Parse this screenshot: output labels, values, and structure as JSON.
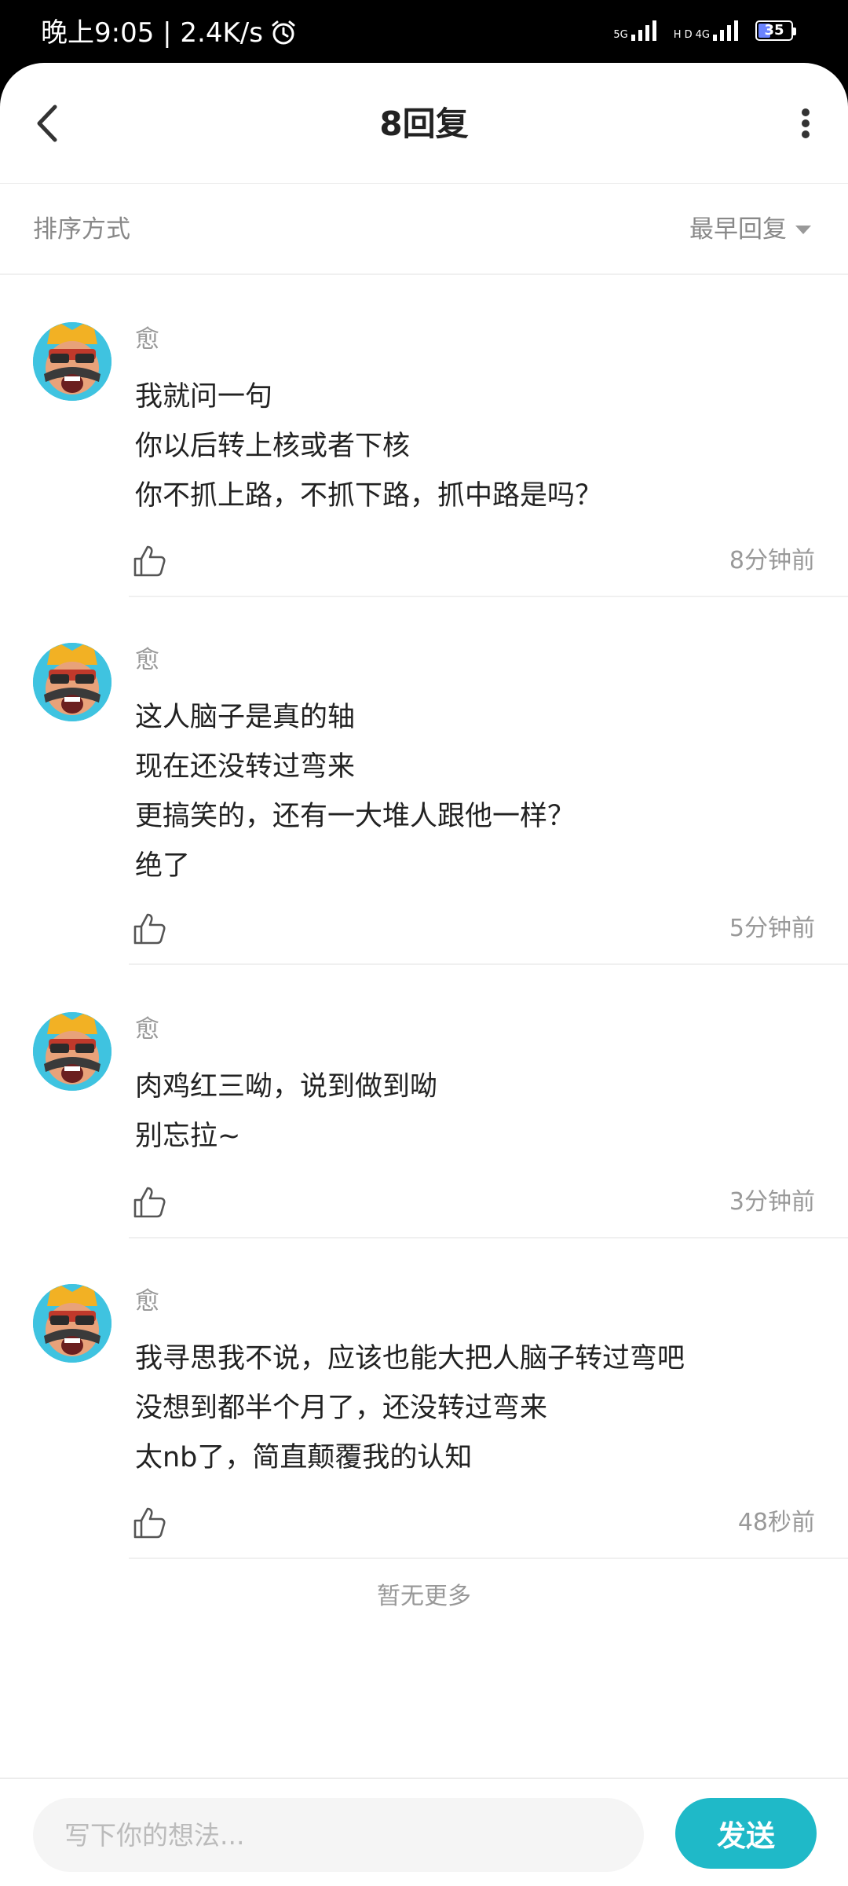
{
  "status_bar": {
    "time_speed": "晚上9:05 | 2.4K/s",
    "net_5g": "5G",
    "net_hd": "H D",
    "net_4g": "4G",
    "battery": "35"
  },
  "header": {
    "title": "8回复",
    "back_icon": "chevron-left-icon",
    "more_icon": "vertical-dots-icon"
  },
  "sort": {
    "label": "排序方式",
    "value": "最早回复"
  },
  "comments": [
    {
      "author": "愈",
      "lines": [
        "我就问一句",
        "你以后转上核或者下核",
        "你不抓上路，不抓下路，抓中路是吗？"
      ],
      "time": "8分钟前"
    },
    {
      "author": "愈",
      "lines": [
        "这人脑子是真的轴",
        "现在还没转过弯来",
        "更搞笑的，还有一大堆人跟他一样？",
        "绝了"
      ],
      "time": "5分钟前"
    },
    {
      "author": "愈",
      "lines": [
        "肉鸡红三呦，说到做到呦",
        "别忘拉~"
      ],
      "time": "3分钟前"
    },
    {
      "author": "愈",
      "lines": [
        "我寻思我不说，应该也能大把人脑子转过弯吧",
        "没想到都半个月了，还没转过弯来",
        "太nb了，简直颠覆我的认知"
      ],
      "time": "48秒前"
    }
  ],
  "footer_text": "暂无更多",
  "composer": {
    "placeholder": "写下你的想法...",
    "send_label": "发送"
  },
  "colors": {
    "accent": "#1fb9c8",
    "avatar_bg": "#3fc3e0",
    "battery": "#6b84ff"
  }
}
